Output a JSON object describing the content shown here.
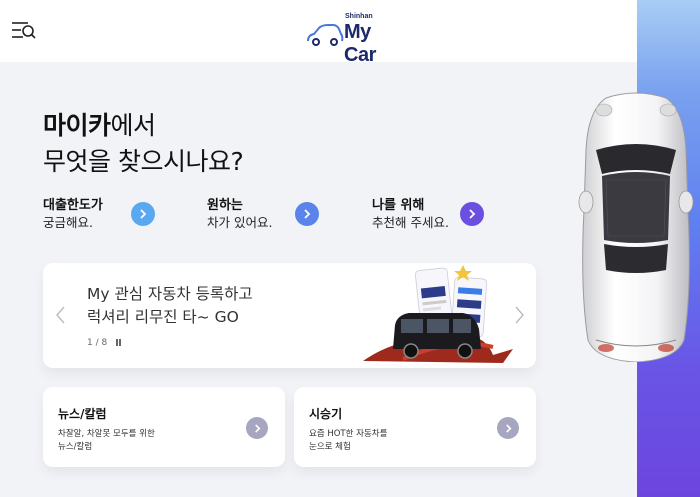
{
  "header": {
    "logo_small": "Shinhan",
    "logo_main": "My Car",
    "menu_icon": "menu-search-icon"
  },
  "headline": {
    "bold": "마이카",
    "line1_rest": "에서",
    "line2": "무엇을 찾으시나요?"
  },
  "quick_links": [
    {
      "title": "대출한도가",
      "subtitle": "궁금해요.",
      "color": "#5aa8f0"
    },
    {
      "title": "원하는",
      "subtitle": "차가 있어요.",
      "color": "#5b84ea"
    },
    {
      "title": "나를 위해",
      "subtitle": "추천해 주세요.",
      "color": "#6a4fe0"
    }
  ],
  "banner": {
    "line1": "My 관심 자동차 등록하고",
    "line2": "럭셔리 리무진 타~ GO",
    "page": "1 / 8"
  },
  "cards": [
    {
      "title": "뉴스/칼럼",
      "desc_line1": "차잘알, 차알못 모두를 위한",
      "desc_line2": "뉴스/칼럼"
    },
    {
      "title": "시승기",
      "desc_line1": "요즘 HOT한 자동차를",
      "desc_line2": "눈으로 체험"
    }
  ],
  "colors": {
    "accent_blue": "#5aa8f0",
    "accent_indigo": "#5b84ea",
    "accent_purple": "#6a4fe0",
    "card_button": "#a6a6c0",
    "brand_navy": "#1c2a6b"
  }
}
